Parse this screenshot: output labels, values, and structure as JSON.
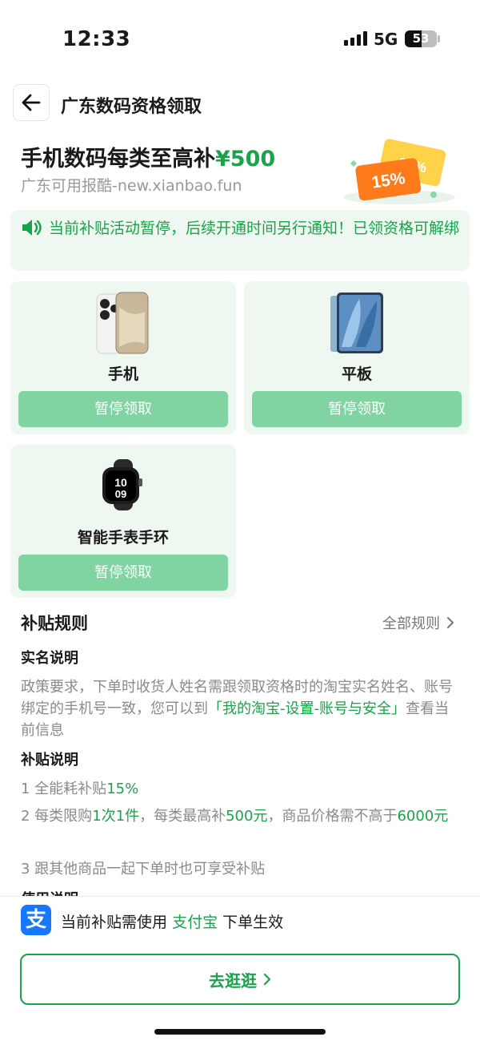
{
  "status_bar": {
    "time": "12:33",
    "network": "5G",
    "battery": "53",
    "battery_level": 0.53
  },
  "nav": {
    "back_icon": "arrow-left-icon",
    "title": "广东数码资格领取"
  },
  "hero": {
    "title_prefix": "手机数码每类至高补",
    "title_amount": "¥500",
    "subtitle": "广东可用报酷-new.xianbao.fun",
    "badge_front": "15%",
    "badge_back": "15%"
  },
  "notice": {
    "icon": "speaker-icon",
    "text": "当前补贴活动暂停，后续开通时间另行通知！已领资格可解绑"
  },
  "categories": [
    {
      "label": "手机",
      "button": "暂停领取",
      "icon": "phone-image"
    },
    {
      "label": "平板",
      "button": "暂停领取",
      "icon": "tablet-image"
    },
    {
      "label": "智能手表手环",
      "button": "暂停领取",
      "icon": "watch-image"
    }
  ],
  "rules": {
    "title": "补贴规则",
    "all_link": "全部规则",
    "realname_title": "实名说明",
    "realname_text_1": "政策要求，下单时收货人姓名需跟领取资格时的淘宝实名姓名、账号绑定的手机号一致，您可以到",
    "realname_link": "「我的淘宝-设置-账号与安全」",
    "realname_text_2": "查看当前信息",
    "subsidy_title": "补贴说明",
    "line1_a": "1 全能耗补贴",
    "line1_b": "15%",
    "line2_a": "2 每类限购",
    "line2_b": "1次1件",
    "line2_c": "，每类最高补",
    "line2_d": "500元",
    "line2_e": "，商品价格需不高于",
    "line2_f": "6000元",
    "line3": "3 跟其他商品一起下单时也可享受补贴",
    "usage_title": "使用说明"
  },
  "bottom": {
    "alipay_icon": "alipay-icon",
    "alipay_glyph": "支",
    "text_a": "当前补贴需使用",
    "text_b": "支付宝",
    "text_c": "下单生效",
    "go_button": "去逛逛"
  },
  "colors": {
    "green": "#1aa34a",
    "light_green_bg": "#eef8f1",
    "disabled_button": "#7fd4a1"
  }
}
